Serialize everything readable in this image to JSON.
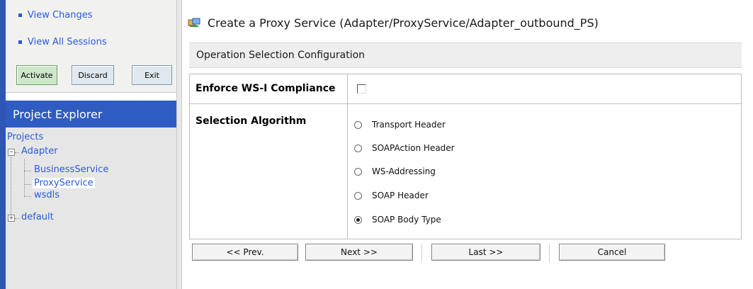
{
  "session": {
    "links": [
      "View Changes",
      "View All Sessions"
    ],
    "buttons": {
      "activate": "Activate",
      "discard": "Discard",
      "exit": "Exit"
    }
  },
  "explorer": {
    "title": "Project Explorer",
    "root": "Projects",
    "tree": {
      "adapter": "Adapter",
      "children": [
        "BusinessService",
        "ProxyService",
        "wsdls"
      ],
      "selected": "ProxyService",
      "default": "default"
    }
  },
  "main": {
    "title": "Create a Proxy Service (Adapter/ProxyService/Adapter_outbound_PS)",
    "section": "Operation Selection Configuration",
    "form": {
      "enforce_label": "Enforce WS-I Compliance",
      "enforce_checked": false,
      "algorithm_label": "Selection Algorithm",
      "options": [
        "Transport Header",
        "SOAPAction Header",
        "WS-Addressing",
        "SOAP Header",
        "SOAP Body Type"
      ],
      "selected_option": "SOAP Body Type"
    },
    "nav": {
      "prev": "<< Prev.",
      "next": "Next >>",
      "last": "Last >>",
      "cancel": "Cancel"
    }
  },
  "colors": {
    "accent_blue": "#2f5cc0",
    "link_blue": "#2a5bd7",
    "activate_green": "#cde7c9"
  }
}
